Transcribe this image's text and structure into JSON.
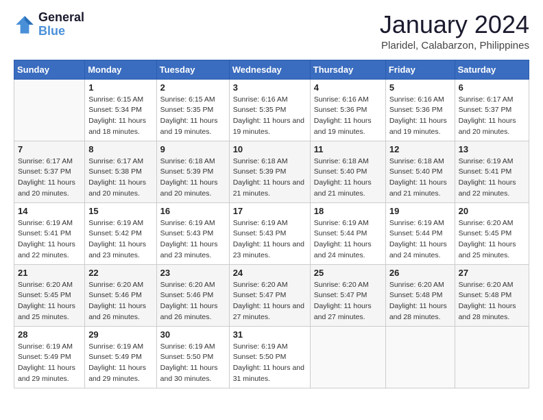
{
  "header": {
    "logo_line1": "General",
    "logo_line2": "Blue",
    "main_title": "January 2024",
    "subtitle": "Plaridel, Calabarzon, Philippines"
  },
  "weekdays": [
    "Sunday",
    "Monday",
    "Tuesday",
    "Wednesday",
    "Thursday",
    "Friday",
    "Saturday"
  ],
  "weeks": [
    [
      {
        "day": "",
        "sunrise": "",
        "sunset": "",
        "daylight": ""
      },
      {
        "day": "1",
        "sunrise": "Sunrise: 6:15 AM",
        "sunset": "Sunset: 5:34 PM",
        "daylight": "Daylight: 11 hours and 18 minutes."
      },
      {
        "day": "2",
        "sunrise": "Sunrise: 6:15 AM",
        "sunset": "Sunset: 5:35 PM",
        "daylight": "Daylight: 11 hours and 19 minutes."
      },
      {
        "day": "3",
        "sunrise": "Sunrise: 6:16 AM",
        "sunset": "Sunset: 5:35 PM",
        "daylight": "Daylight: 11 hours and 19 minutes."
      },
      {
        "day": "4",
        "sunrise": "Sunrise: 6:16 AM",
        "sunset": "Sunset: 5:36 PM",
        "daylight": "Daylight: 11 hours and 19 minutes."
      },
      {
        "day": "5",
        "sunrise": "Sunrise: 6:16 AM",
        "sunset": "Sunset: 5:36 PM",
        "daylight": "Daylight: 11 hours and 19 minutes."
      },
      {
        "day": "6",
        "sunrise": "Sunrise: 6:17 AM",
        "sunset": "Sunset: 5:37 PM",
        "daylight": "Daylight: 11 hours and 20 minutes."
      }
    ],
    [
      {
        "day": "7",
        "sunrise": "Sunrise: 6:17 AM",
        "sunset": "Sunset: 5:37 PM",
        "daylight": "Daylight: 11 hours and 20 minutes."
      },
      {
        "day": "8",
        "sunrise": "Sunrise: 6:17 AM",
        "sunset": "Sunset: 5:38 PM",
        "daylight": "Daylight: 11 hours and 20 minutes."
      },
      {
        "day": "9",
        "sunrise": "Sunrise: 6:18 AM",
        "sunset": "Sunset: 5:39 PM",
        "daylight": "Daylight: 11 hours and 20 minutes."
      },
      {
        "day": "10",
        "sunrise": "Sunrise: 6:18 AM",
        "sunset": "Sunset: 5:39 PM",
        "daylight": "Daylight: 11 hours and 21 minutes."
      },
      {
        "day": "11",
        "sunrise": "Sunrise: 6:18 AM",
        "sunset": "Sunset: 5:40 PM",
        "daylight": "Daylight: 11 hours and 21 minutes."
      },
      {
        "day": "12",
        "sunrise": "Sunrise: 6:18 AM",
        "sunset": "Sunset: 5:40 PM",
        "daylight": "Daylight: 11 hours and 21 minutes."
      },
      {
        "day": "13",
        "sunrise": "Sunrise: 6:19 AM",
        "sunset": "Sunset: 5:41 PM",
        "daylight": "Daylight: 11 hours and 22 minutes."
      }
    ],
    [
      {
        "day": "14",
        "sunrise": "Sunrise: 6:19 AM",
        "sunset": "Sunset: 5:41 PM",
        "daylight": "Daylight: 11 hours and 22 minutes."
      },
      {
        "day": "15",
        "sunrise": "Sunrise: 6:19 AM",
        "sunset": "Sunset: 5:42 PM",
        "daylight": "Daylight: 11 hours and 23 minutes."
      },
      {
        "day": "16",
        "sunrise": "Sunrise: 6:19 AM",
        "sunset": "Sunset: 5:43 PM",
        "daylight": "Daylight: 11 hours and 23 minutes."
      },
      {
        "day": "17",
        "sunrise": "Sunrise: 6:19 AM",
        "sunset": "Sunset: 5:43 PM",
        "daylight": "Daylight: 11 hours and 23 minutes."
      },
      {
        "day": "18",
        "sunrise": "Sunrise: 6:19 AM",
        "sunset": "Sunset: 5:44 PM",
        "daylight": "Daylight: 11 hours and 24 minutes."
      },
      {
        "day": "19",
        "sunrise": "Sunrise: 6:19 AM",
        "sunset": "Sunset: 5:44 PM",
        "daylight": "Daylight: 11 hours and 24 minutes."
      },
      {
        "day": "20",
        "sunrise": "Sunrise: 6:20 AM",
        "sunset": "Sunset: 5:45 PM",
        "daylight": "Daylight: 11 hours and 25 minutes."
      }
    ],
    [
      {
        "day": "21",
        "sunrise": "Sunrise: 6:20 AM",
        "sunset": "Sunset: 5:45 PM",
        "daylight": "Daylight: 11 hours and 25 minutes."
      },
      {
        "day": "22",
        "sunrise": "Sunrise: 6:20 AM",
        "sunset": "Sunset: 5:46 PM",
        "daylight": "Daylight: 11 hours and 26 minutes."
      },
      {
        "day": "23",
        "sunrise": "Sunrise: 6:20 AM",
        "sunset": "Sunset: 5:46 PM",
        "daylight": "Daylight: 11 hours and 26 minutes."
      },
      {
        "day": "24",
        "sunrise": "Sunrise: 6:20 AM",
        "sunset": "Sunset: 5:47 PM",
        "daylight": "Daylight: 11 hours and 27 minutes."
      },
      {
        "day": "25",
        "sunrise": "Sunrise: 6:20 AM",
        "sunset": "Sunset: 5:47 PM",
        "daylight": "Daylight: 11 hours and 27 minutes."
      },
      {
        "day": "26",
        "sunrise": "Sunrise: 6:20 AM",
        "sunset": "Sunset: 5:48 PM",
        "daylight": "Daylight: 11 hours and 28 minutes."
      },
      {
        "day": "27",
        "sunrise": "Sunrise: 6:20 AM",
        "sunset": "Sunset: 5:48 PM",
        "daylight": "Daylight: 11 hours and 28 minutes."
      }
    ],
    [
      {
        "day": "28",
        "sunrise": "Sunrise: 6:19 AM",
        "sunset": "Sunset: 5:49 PM",
        "daylight": "Daylight: 11 hours and 29 minutes."
      },
      {
        "day": "29",
        "sunrise": "Sunrise: 6:19 AM",
        "sunset": "Sunset: 5:49 PM",
        "daylight": "Daylight: 11 hours and 29 minutes."
      },
      {
        "day": "30",
        "sunrise": "Sunrise: 6:19 AM",
        "sunset": "Sunset: 5:50 PM",
        "daylight": "Daylight: 11 hours and 30 minutes."
      },
      {
        "day": "31",
        "sunrise": "Sunrise: 6:19 AM",
        "sunset": "Sunset: 5:50 PM",
        "daylight": "Daylight: 11 hours and 31 minutes."
      },
      {
        "day": "",
        "sunrise": "",
        "sunset": "",
        "daylight": ""
      },
      {
        "day": "",
        "sunrise": "",
        "sunset": "",
        "daylight": ""
      },
      {
        "day": "",
        "sunrise": "",
        "sunset": "",
        "daylight": ""
      }
    ]
  ]
}
